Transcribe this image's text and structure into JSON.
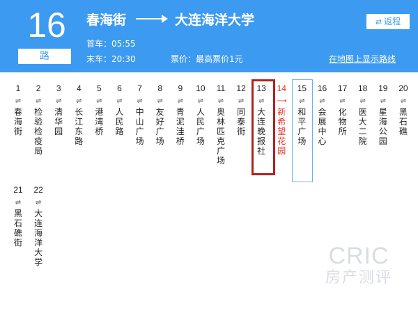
{
  "header": {
    "route_number": "16",
    "route_unit": "路",
    "from": "春海街",
    "to": "大连海洋大学",
    "first_bus": "首车：05:55",
    "last_bus": "末车：20:30",
    "fare": "票价：最高票价1元",
    "return_label": "返程",
    "map_link": "在地图上显示路线"
  },
  "stops": [
    {
      "num": "1",
      "name": "春海街"
    },
    {
      "num": "2",
      "name": "检验检疫局"
    },
    {
      "num": "3",
      "name": "清华园"
    },
    {
      "num": "4",
      "name": "长江东路"
    },
    {
      "num": "5",
      "name": "港湾桥"
    },
    {
      "num": "6",
      "name": "人民路"
    },
    {
      "num": "7",
      "name": "中山广场"
    },
    {
      "num": "8",
      "name": "友好广场"
    },
    {
      "num": "9",
      "name": "青泥洼桥"
    },
    {
      "num": "10",
      "name": "人民广场"
    },
    {
      "num": "11",
      "name": "奥林匹克广场"
    },
    {
      "num": "12",
      "name": "同泰街"
    },
    {
      "num": "13",
      "name": "大连晚报社"
    },
    {
      "num": "14",
      "name": "新希望花园"
    },
    {
      "num": "15",
      "name": "和平广场"
    },
    {
      "num": "16",
      "name": "会展中心"
    },
    {
      "num": "17",
      "name": "化物所"
    },
    {
      "num": "18",
      "name": "医大二院"
    },
    {
      "num": "19",
      "name": "星海公园"
    },
    {
      "num": "20",
      "name": "黑石礁"
    },
    {
      "num": "21",
      "name": "黑石礁街"
    },
    {
      "num": "22",
      "name": "大连海洋大学"
    }
  ],
  "icons": {
    "swap": "⇄",
    "bidirectional": "⇌",
    "current_direction": "⟶"
  },
  "watermark": {
    "main": "CRIC",
    "sub": "房产测评"
  },
  "colors": {
    "header_bg": "#3c9af0",
    "current_stop": "#e8302a",
    "selected_border": "#b2201e",
    "highlight_border": "#6fb4ea"
  }
}
